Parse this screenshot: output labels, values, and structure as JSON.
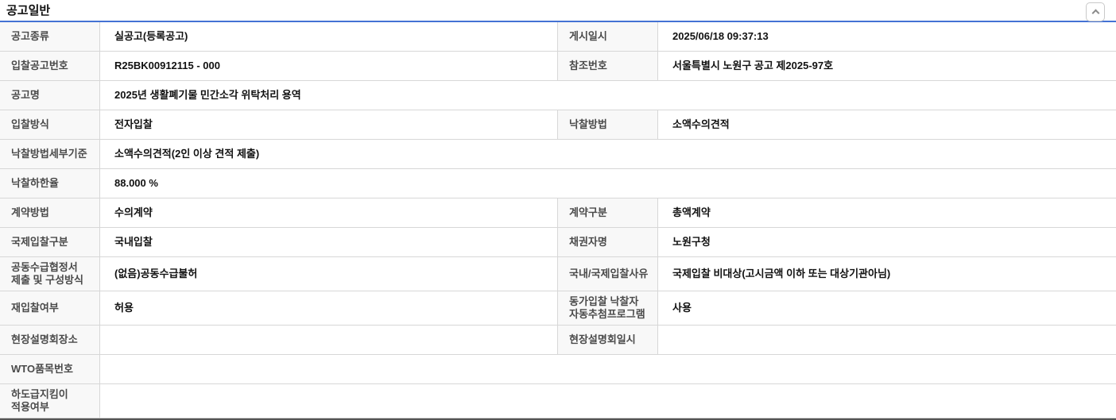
{
  "page": {
    "title": "공고일반"
  },
  "header": {
    "collapse_button": "collapse-section",
    "icon": "chevron-up-icon"
  },
  "colors": {
    "accent_line": "#4472d4",
    "table_bottom_border": "#555555",
    "row_border": "#d7d7d7",
    "label_cell_bg": "#f8f8f8"
  },
  "table": {
    "rows": [
      {
        "type": "double",
        "left": {
          "label": "공고종류",
          "value": "실공고(등록공고)"
        },
        "right": {
          "label": "게시일시",
          "value": "2025/06/18 09:37:13"
        }
      },
      {
        "type": "double",
        "left": {
          "label": "입찰공고번호",
          "value": "R25BK00912115 - 000"
        },
        "right": {
          "label": "참조번호",
          "value": "서울특별시 노원구 공고 제2025-97호"
        }
      },
      {
        "type": "full",
        "left": {
          "label": "공고명",
          "value": "2025년 생활폐기물 민간소각 위탁처리 용역"
        }
      },
      {
        "type": "double",
        "left": {
          "label": "입찰방식",
          "value": "전자입찰"
        },
        "right": {
          "label": "낙찰방법",
          "value": "소액수의견적"
        }
      },
      {
        "type": "full",
        "left": {
          "label": "낙찰방법세부기준",
          "value": "소액수의견적(2인 이상 견적 제출)"
        }
      },
      {
        "type": "full",
        "left": {
          "label": "낙찰하한율",
          "value": "88.000 %"
        }
      },
      {
        "type": "double",
        "left": {
          "label": "계약방법",
          "value": "수의계약"
        },
        "right": {
          "label": "계약구분",
          "value": "총액계약"
        }
      },
      {
        "type": "double",
        "left": {
          "label": "국제입찰구분",
          "value": "국내입찰"
        },
        "right": {
          "label": "채권자명",
          "value": "노원구청"
        }
      },
      {
        "type": "double",
        "left": {
          "label": "공동수급협정서\n제출 및 구성방식",
          "value": "(없음)공동수급불허"
        },
        "right": {
          "label": "국내/국제입찰사유",
          "value": "국제입찰 비대상(고시금액 이하 또는 대상기관아님)"
        }
      },
      {
        "type": "double",
        "left": {
          "label": "재입찰여부",
          "value": "허용"
        },
        "right": {
          "label": "동가입찰 낙찰자\n자동추첨프로그램",
          "value": "사용"
        }
      },
      {
        "type": "double",
        "left": {
          "label": "현장설명회장소",
          "value": ""
        },
        "right": {
          "label": "현장설명회일시",
          "value": ""
        }
      },
      {
        "type": "full",
        "left": {
          "label": "WTO품목번호",
          "value": ""
        }
      },
      {
        "type": "full",
        "left": {
          "label": "하도급지킴이\n적용여부",
          "value": ""
        }
      }
    ]
  }
}
